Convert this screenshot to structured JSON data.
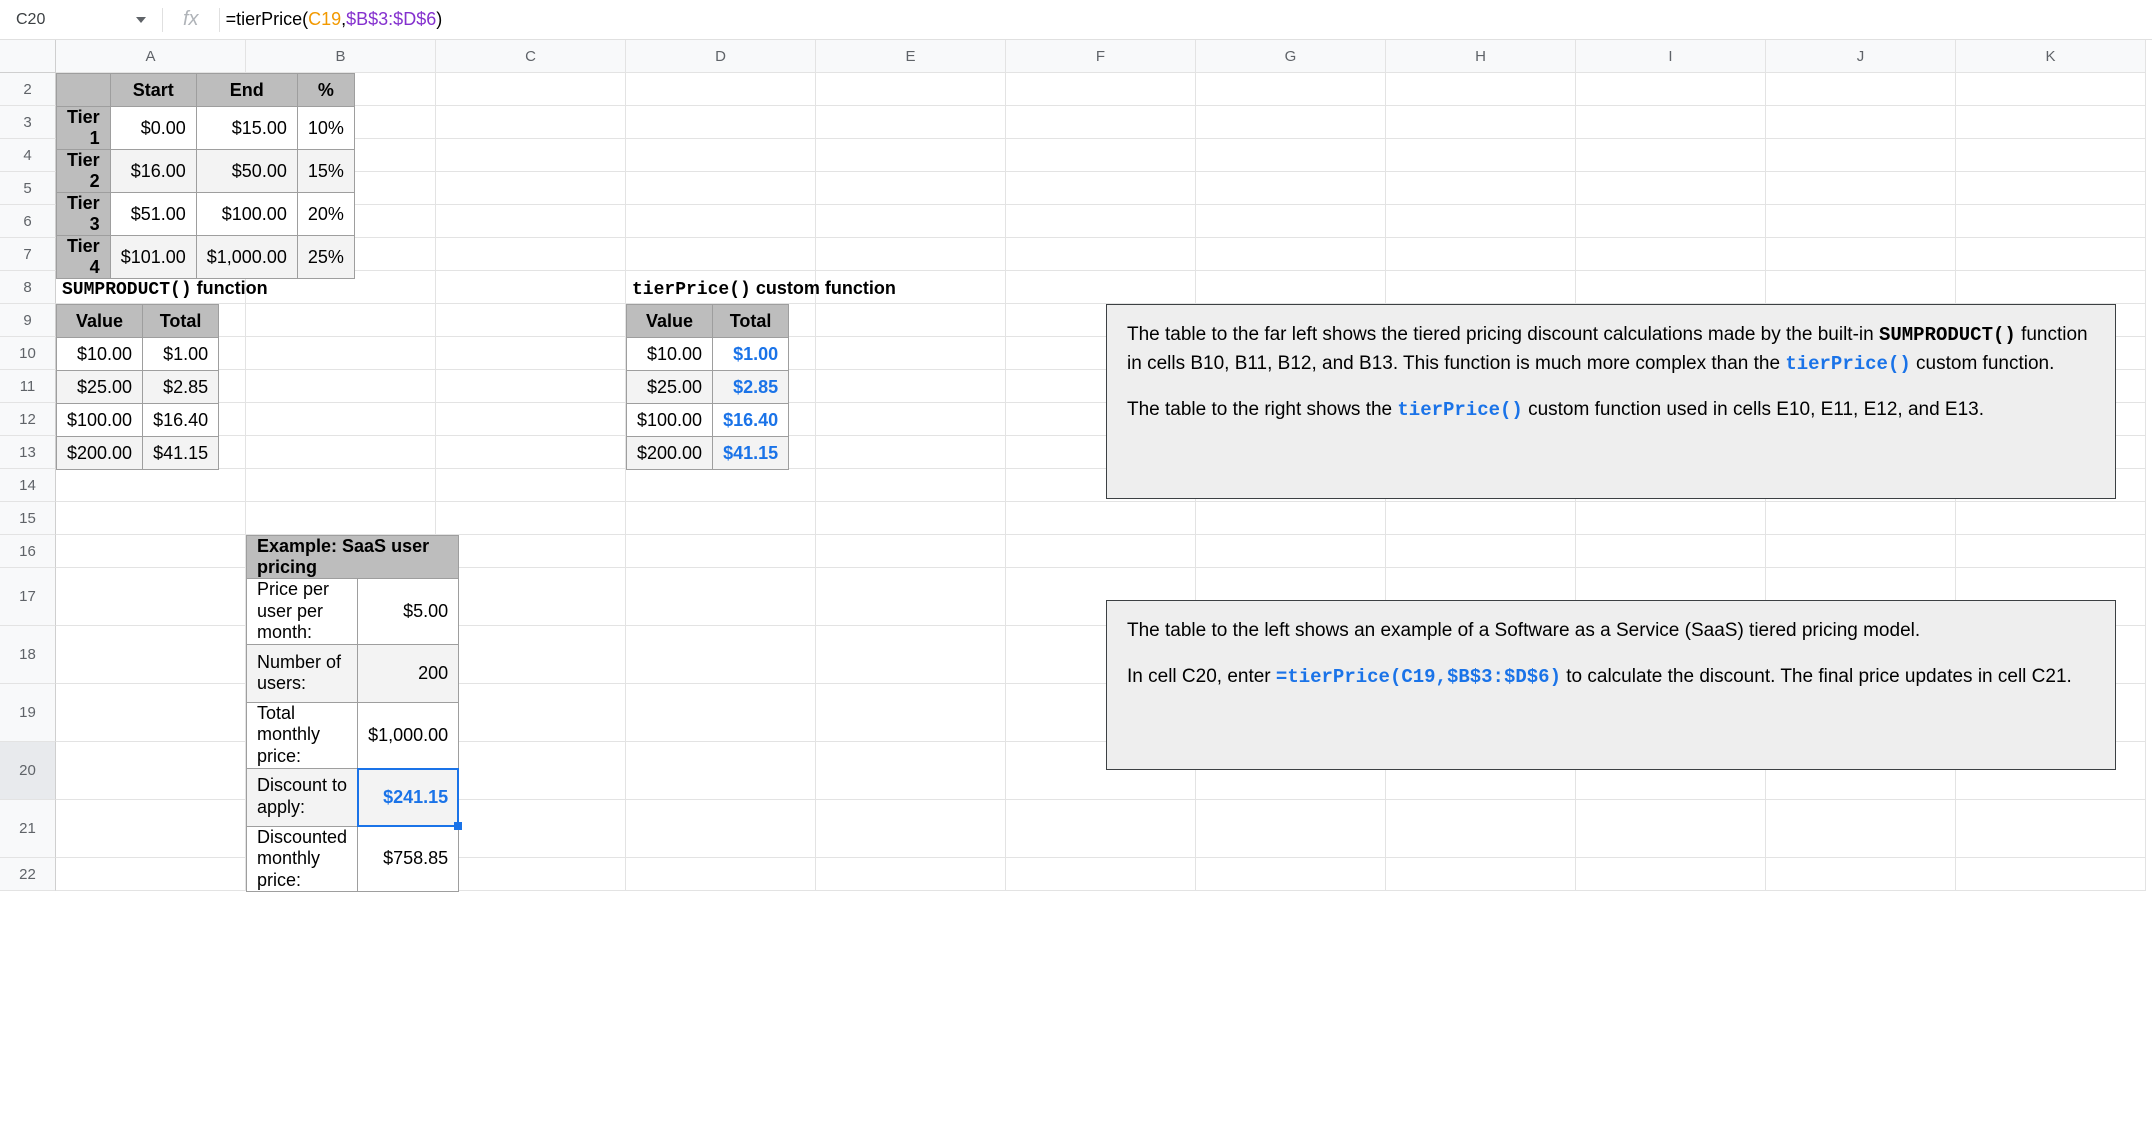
{
  "formula_bar": {
    "cell_ref": "C20",
    "fx_label": "fx",
    "eq": "=",
    "fn": "tierPrice",
    "open": "(",
    "arg1": "C19",
    "comma": ",",
    "arg2": "$B$3:$D$6",
    "close": ")"
  },
  "columns": [
    "A",
    "B",
    "C",
    "D",
    "E",
    "F",
    "G",
    "H",
    "I",
    "J",
    "K"
  ],
  "rows": [
    "2",
    "3",
    "4",
    "5",
    "6",
    "7",
    "8",
    "9",
    "10",
    "11",
    "12",
    "13",
    "14",
    "15",
    "16",
    "17",
    "18",
    "19",
    "20",
    "21",
    "22"
  ],
  "selected_row": "20",
  "tiers": {
    "headers": {
      "start": "Start",
      "end": "End",
      "pct": "%"
    },
    "rows": [
      {
        "label": "Tier 1",
        "start": "$0.00",
        "end": "$15.00",
        "pct": "10%"
      },
      {
        "label": "Tier 2",
        "start": "$16.00",
        "end": "$50.00",
        "pct": "15%"
      },
      {
        "label": "Tier 3",
        "start": "$51.00",
        "end": "$100.00",
        "pct": "20%"
      },
      {
        "label": "Tier 4",
        "start": "$101.00",
        "end": "$1,000.00",
        "pct": "25%"
      }
    ]
  },
  "section_titles": {
    "sumproduct_pre": "SUMPRODUCT()",
    "sumproduct_post": " function",
    "tierprice_pre": "tierPrice()",
    "tierprice_post": " custom function"
  },
  "comp_headers": {
    "value": "Value",
    "total": "Total"
  },
  "sumproduct_tbl": [
    {
      "value": "$10.00",
      "total": "$1.00"
    },
    {
      "value": "$25.00",
      "total": "$2.85"
    },
    {
      "value": "$100.00",
      "total": "$16.40"
    },
    {
      "value": "$200.00",
      "total": "$41.15"
    }
  ],
  "tierprice_tbl": [
    {
      "value": "$10.00",
      "total": "$1.00"
    },
    {
      "value": "$25.00",
      "total": "$2.85"
    },
    {
      "value": "$100.00",
      "total": "$16.40"
    },
    {
      "value": "$200.00",
      "total": "$41.15"
    }
  ],
  "saas": {
    "title": "Example: SaaS user pricing",
    "rows": [
      {
        "label": "Price per user per month:",
        "value": "$5.00"
      },
      {
        "label": "Number of users:",
        "value": "200"
      },
      {
        "label": "Total monthly price:",
        "value": "$1,000.00"
      },
      {
        "label": "Discount to apply:",
        "value": "$241.15"
      },
      {
        "label": "Discounted monthly price:",
        "value": "$758.85"
      }
    ]
  },
  "note1": {
    "t1a": "The table to the far left shows the tiered pricing discount calculations made by the built-in ",
    "t1b": "SUMPRODUCT()",
    "t1c": " function in cells B10, B11, B12, and B13. This function is much more complex than the ",
    "t1d": "tierPrice()",
    "t1e": " custom function.",
    "t2a": "The table to the right shows the ",
    "t2b": "tierPrice()",
    "t2c": " custom function used in cells E10, E11, E12, and E13."
  },
  "note2": {
    "t1": "The table to the left shows an example of a Software as a Service (SaaS) tiered pricing model.",
    "t2a": "In cell C20, enter ",
    "t2b": "=tierPrice(C19,$B$3:$D$6)",
    "t2c": " to calculate the discount. The final price updates in cell C21."
  }
}
